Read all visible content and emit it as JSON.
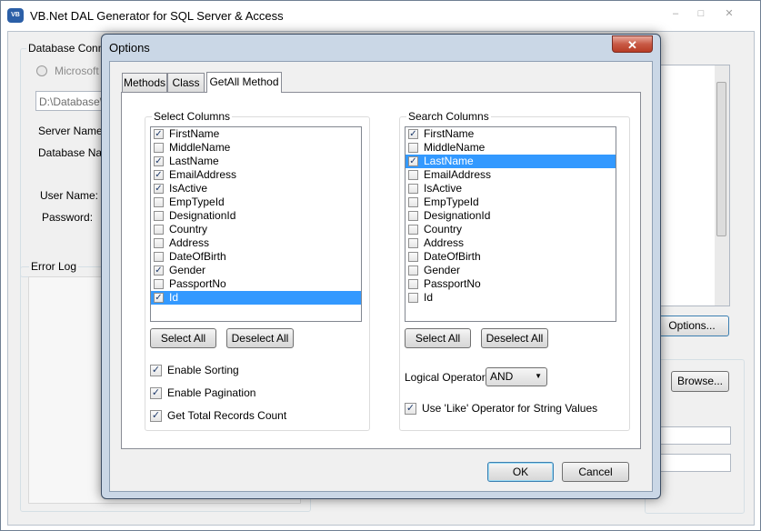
{
  "main_window": {
    "title": "VB.Net DAL Generator for SQL Server & Access",
    "app_icon_text": "VB",
    "controls": {
      "minimize": "–",
      "maximize": "□",
      "close": "✕"
    },
    "database_connection_label": "Database Conne",
    "microsoft_radio_label": "Microsoft S",
    "db_path_value": "D:\\Database\\",
    "server_name_label": "Server Name:",
    "database_name_label": "Database Nam",
    "user_name_label": "User Name:",
    "password_label": "Password:",
    "error_log_label": "Error Log",
    "options_button": "Options...",
    "browse_button": "Browse..."
  },
  "dialog": {
    "title": "Options",
    "close_glyph": "✕",
    "tabs": [
      {
        "label": "Methods",
        "active": false
      },
      {
        "label": "Class",
        "active": false
      },
      {
        "label": "GetAll Method",
        "active": true
      }
    ],
    "select_columns": {
      "label": "Select Columns",
      "items": [
        {
          "name": "FirstName",
          "checked": true,
          "selected": false
        },
        {
          "name": "MiddleName",
          "checked": false,
          "selected": false
        },
        {
          "name": "LastName",
          "checked": true,
          "selected": false
        },
        {
          "name": "EmailAddress",
          "checked": true,
          "selected": false
        },
        {
          "name": "IsActive",
          "checked": true,
          "selected": false
        },
        {
          "name": "EmpTypeId",
          "checked": false,
          "selected": false
        },
        {
          "name": "DesignationId",
          "checked": false,
          "selected": false
        },
        {
          "name": "Country",
          "checked": false,
          "selected": false
        },
        {
          "name": "Address",
          "checked": false,
          "selected": false
        },
        {
          "name": "DateOfBirth",
          "checked": false,
          "selected": false
        },
        {
          "name": "Gender",
          "checked": true,
          "selected": false
        },
        {
          "name": "PassportNo",
          "checked": false,
          "selected": false
        },
        {
          "name": "Id",
          "checked": true,
          "selected": true
        }
      ],
      "select_all": "Select All",
      "deselect_all": "Deselect All",
      "options": [
        {
          "label": "Enable Sorting",
          "checked": true
        },
        {
          "label": "Enable Pagination",
          "checked": true
        },
        {
          "label": "Get Total Records Count",
          "checked": true
        }
      ]
    },
    "search_columns": {
      "label": "Search Columns",
      "items": [
        {
          "name": "FirstName",
          "checked": true,
          "selected": false
        },
        {
          "name": "MiddleName",
          "checked": false,
          "selected": false
        },
        {
          "name": "LastName",
          "checked": true,
          "selected": true
        },
        {
          "name": "EmailAddress",
          "checked": false,
          "selected": false
        },
        {
          "name": "IsActive",
          "checked": false,
          "selected": false
        },
        {
          "name": "EmpTypeId",
          "checked": false,
          "selected": false
        },
        {
          "name": "DesignationId",
          "checked": false,
          "selected": false
        },
        {
          "name": "Country",
          "checked": false,
          "selected": false
        },
        {
          "name": "Address",
          "checked": false,
          "selected": false
        },
        {
          "name": "DateOfBirth",
          "checked": false,
          "selected": false
        },
        {
          "name": "Gender",
          "checked": false,
          "selected": false
        },
        {
          "name": "PassportNo",
          "checked": false,
          "selected": false
        },
        {
          "name": "Id",
          "checked": false,
          "selected": false
        }
      ],
      "select_all": "Select All",
      "deselect_all": "Deselect All",
      "logical_operator_label": "Logical Operator:",
      "logical_operator_value": "AND",
      "use_like": {
        "label": "Use 'Like' Operator for String Values",
        "checked": true
      }
    },
    "ok_button": "OK",
    "cancel_button": "Cancel"
  },
  "colors": {
    "selection": "#3399ff",
    "window_bg": "#f0f0f0",
    "frame": "#cad7e6"
  }
}
